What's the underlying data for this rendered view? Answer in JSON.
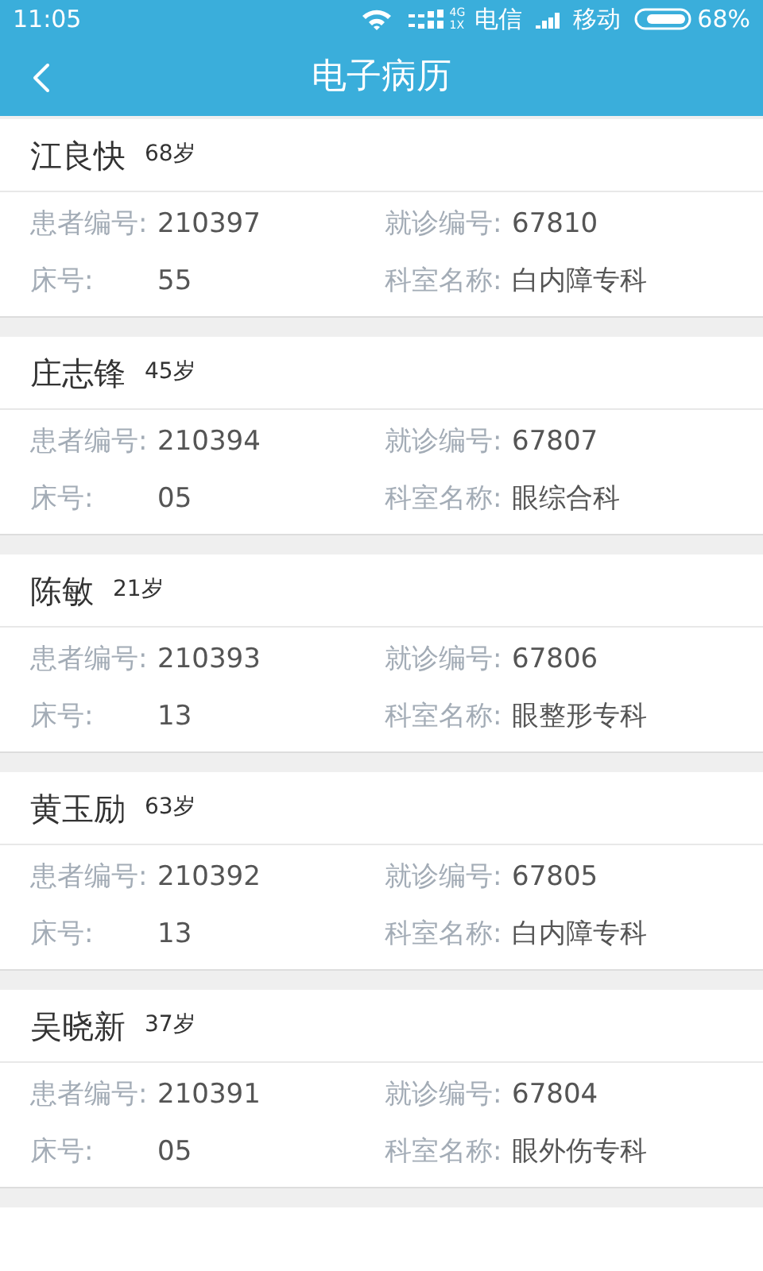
{
  "status_bar": {
    "time": "11:05",
    "network_top": "4G",
    "network_bottom": "1X",
    "carrier_1": "电信",
    "carrier_2": "移动",
    "battery": "68%"
  },
  "header": {
    "title": "电子病历"
  },
  "records": [
    {
      "name": "江良快",
      "age": "68岁",
      "fields": [
        {
          "label": "患者编号:",
          "value": "210397"
        },
        {
          "label": "就诊编号:",
          "value": "67810"
        },
        {
          "label": "床号:",
          "value": "55"
        },
        {
          "label": "科室名称:",
          "value": "白内障专科"
        }
      ]
    },
    {
      "name": "庄志锋",
      "age": "45岁",
      "fields": [
        {
          "label": "患者编号:",
          "value": "210394"
        },
        {
          "label": "就诊编号:",
          "value": "67807"
        },
        {
          "label": "床号:",
          "value": "05"
        },
        {
          "label": "科室名称:",
          "value": "眼综合科"
        }
      ]
    },
    {
      "name": "陈敏",
      "age": "21岁",
      "fields": [
        {
          "label": "患者编号:",
          "value": "210393"
        },
        {
          "label": "就诊编号:",
          "value": "67806"
        },
        {
          "label": "床号:",
          "value": "13"
        },
        {
          "label": "科室名称:",
          "value": "眼整形专科"
        }
      ]
    },
    {
      "name": "黄玉励",
      "age": "63岁",
      "fields": [
        {
          "label": "患者编号:",
          "value": "210392"
        },
        {
          "label": "就诊编号:",
          "value": "67805"
        },
        {
          "label": "床号:",
          "value": "13"
        },
        {
          "label": "科室名称:",
          "value": "白内障专科"
        }
      ]
    },
    {
      "name": "吴晓新",
      "age": "37岁",
      "fields": [
        {
          "label": "患者编号:",
          "value": "210391"
        },
        {
          "label": "就诊编号:",
          "value": "67804"
        },
        {
          "label": "床号:",
          "value": "05"
        },
        {
          "label": "科室名称:",
          "value": "眼外伤专科"
        }
      ]
    }
  ]
}
